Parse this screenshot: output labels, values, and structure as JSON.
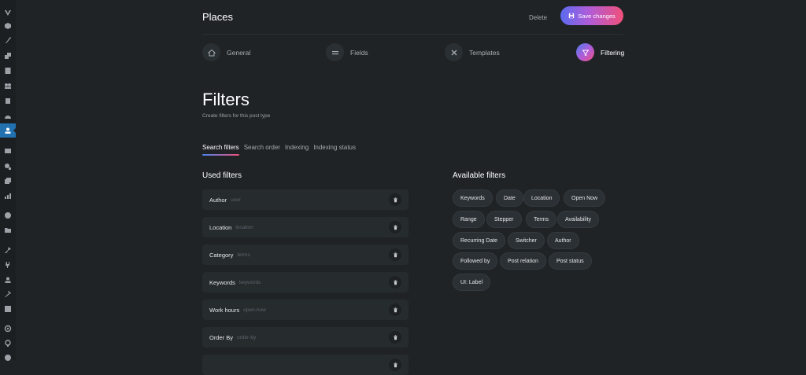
{
  "header": {
    "title": "Places",
    "delete_label": "Delete",
    "save_label": "Save changes"
  },
  "steps": [
    {
      "label": "General",
      "icon": "home-icon",
      "active": false
    },
    {
      "label": "Fields",
      "icon": "fields-icon",
      "active": false
    },
    {
      "label": "Templates",
      "icon": "templates-icon",
      "active": false
    },
    {
      "label": "Filtering",
      "icon": "filter-icon",
      "active": true
    }
  ],
  "section": {
    "title": "Filters",
    "subtitle": "Create filters for this post type"
  },
  "subtabs": [
    {
      "label": "Search filters",
      "active": true
    },
    {
      "label": "Search order",
      "active": false
    },
    {
      "label": "Indexing",
      "active": false
    },
    {
      "label": "Indexing status",
      "active": false
    }
  ],
  "used_filters": {
    "title": "Used filters",
    "items": [
      {
        "name": "Author",
        "key": "user"
      },
      {
        "name": "Location",
        "key": "location"
      },
      {
        "name": "Category",
        "key": "terms"
      },
      {
        "name": "Keywords",
        "key": "keywords"
      },
      {
        "name": "Work hours",
        "key": "open-now"
      },
      {
        "name": "Order By",
        "key": "order-by"
      }
    ]
  },
  "available_filters": {
    "title": "Available filters",
    "items": [
      "Keywords",
      "Date",
      "Location",
      "Open Now",
      "Range",
      "Stepper",
      "Terms",
      "Availability",
      "Recurring Date",
      "Switcher",
      "Author",
      "Followed by",
      "Post relation",
      "Post status",
      "UI: Label"
    ]
  },
  "colors": {
    "background": "#1f2326",
    "sidebar": "#1b1f22",
    "sidebar_active": "#2271b1",
    "accent_gradient_start": "#5b6bf0",
    "accent_gradient_end": "#f0507a"
  }
}
